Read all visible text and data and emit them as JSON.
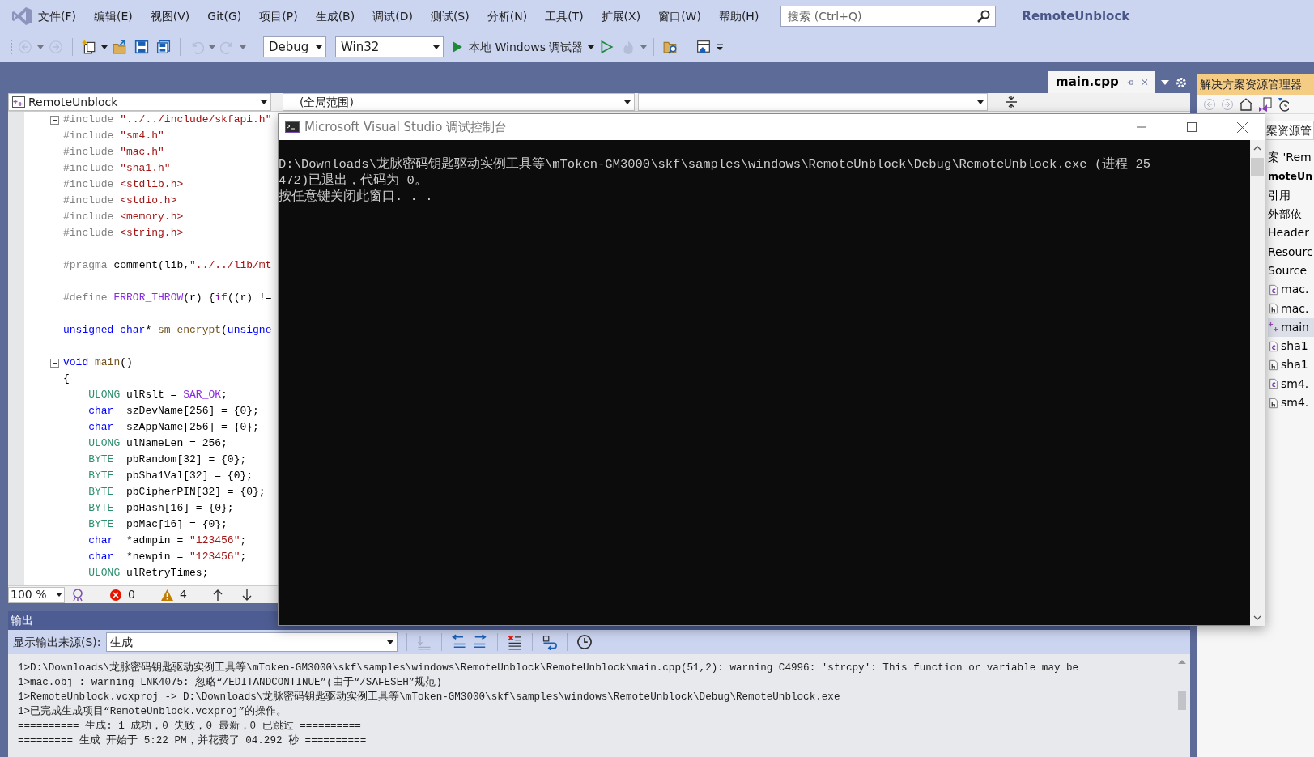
{
  "menu": [
    "文件(F)",
    "编辑(E)",
    "视图(V)",
    "Git(G)",
    "项目(P)",
    "生成(B)",
    "调试(D)",
    "测试(S)",
    "分析(N)",
    "工具(T)",
    "扩展(X)",
    "窗口(W)",
    "帮助(H)"
  ],
  "search": {
    "placeholder": "搜索 (Ctrl+Q)"
  },
  "solution_title": "RemoteUnblock",
  "toolbar": [
    {
      "kind": "back",
      "disabled": true
    },
    {
      "kind": "forward",
      "disabled": true
    },
    {
      "kind": "new",
      "disabled": false
    },
    {
      "kind": "open",
      "disabled": false
    },
    {
      "kind": "save",
      "disabled": false
    },
    {
      "kind": "save_all",
      "disabled": false
    },
    {
      "kind": "undo",
      "disabled": true
    },
    {
      "kind": "redo",
      "disabled": true
    },
    {
      "kind": "select",
      "text": "Debug"
    },
    {
      "kind": "select",
      "text": "Win32"
    },
    {
      "kind": "start",
      "text": "本地 Windows 调试器"
    },
    {
      "kind": "start_nodebug",
      "disabled": false
    },
    {
      "kind": "hot_reload",
      "disabled": true
    },
    {
      "kind": "find_files",
      "disabled": false
    },
    {
      "kind": "window",
      "disabled": false
    }
  ],
  "editor_tab": {
    "label": "main.cpp",
    "selected": true
  },
  "nav_bar": {
    "project": "RemoteUnblock",
    "scope": "(全局范围)"
  },
  "code_lines": [
    {
      "kind": "region",
      "segs": [
        {
          "t": "#include ",
          "kind": "pp"
        },
        {
          "t": "\"../../include/skfapi.h\"",
          "kind": "str"
        }
      ]
    },
    {
      "kind": "line",
      "segs": [
        {
          "t": "#include ",
          "kind": "pp"
        },
        {
          "t": "\"sm4.h\"",
          "kind": "str"
        }
      ]
    },
    {
      "kind": "line",
      "segs": [
        {
          "t": "#include ",
          "kind": "pp"
        },
        {
          "t": "\"mac.h\"",
          "kind": "str"
        }
      ]
    },
    {
      "kind": "line",
      "segs": [
        {
          "t": "#include ",
          "kind": "pp"
        },
        {
          "t": "\"sha1.h\"",
          "kind": "str"
        }
      ]
    },
    {
      "kind": "line",
      "segs": [
        {
          "t": "#include ",
          "kind": "pp"
        },
        {
          "t": "<stdlib.h>",
          "kind": "str"
        }
      ]
    },
    {
      "kind": "line",
      "segs": [
        {
          "t": "#include ",
          "kind": "pp"
        },
        {
          "t": "<stdio.h>",
          "kind": "str"
        }
      ]
    },
    {
      "kind": "line",
      "segs": [
        {
          "t": "#include ",
          "kind": "pp"
        },
        {
          "t": "<memory.h>",
          "kind": "str"
        }
      ]
    },
    {
      "kind": "line",
      "segs": [
        {
          "t": "#include ",
          "kind": "pp"
        },
        {
          "t": "<string.h>",
          "kind": "str"
        }
      ]
    },
    {
      "kind": "blank"
    },
    {
      "kind": "line",
      "segs": [
        {
          "t": "#pragma ",
          "kind": "pp"
        },
        {
          "t": "comment(lib,",
          "kind": "plain"
        },
        {
          "t": "\"../../lib/mt",
          "kind": "str"
        }
      ]
    },
    {
      "kind": "blank"
    },
    {
      "kind": "line",
      "segs": [
        {
          "t": "#define ",
          "kind": "pp"
        },
        {
          "t": "ERROR_THROW",
          "kind": "macro"
        },
        {
          "t": "(r) {",
          "kind": "plain"
        },
        {
          "t": "if",
          "kind": "ctrl"
        },
        {
          "t": "((r) !=",
          "kind": "plain"
        }
      ]
    },
    {
      "kind": "blank"
    },
    {
      "kind": "line",
      "segs": [
        {
          "t": "unsigned char",
          "kind": "kw"
        },
        {
          "t": "* ",
          "kind": "plain"
        },
        {
          "t": "sm_encrypt",
          "kind": "func"
        },
        {
          "t": "(",
          "kind": "plain"
        },
        {
          "t": "unsigne",
          "kind": "kw"
        }
      ]
    },
    {
      "kind": "blank"
    },
    {
      "kind": "region",
      "segs": [
        {
          "t": "void ",
          "kind": "kw"
        },
        {
          "t": "main",
          "kind": "func"
        },
        {
          "t": "()",
          "kind": "plain"
        }
      ]
    },
    {
      "kind": "line",
      "segs": [
        {
          "t": "{",
          "kind": "plain"
        }
      ]
    },
    {
      "kind": "line",
      "segs": [
        {
          "t": "    ULONG ",
          "kind": "type"
        },
        {
          "t": "ulRslt = ",
          "kind": "plain"
        },
        {
          "t": "SAR_OK",
          "kind": "macro"
        },
        {
          "t": ";",
          "kind": "plain"
        }
      ]
    },
    {
      "kind": "line",
      "segs": [
        {
          "t": "    char  ",
          "kind": "kw"
        },
        {
          "t": "szDevName[256] = {0};",
          "kind": "plain"
        }
      ]
    },
    {
      "kind": "line",
      "segs": [
        {
          "t": "    char  ",
          "kind": "kw"
        },
        {
          "t": "szAppName[256] = {0};",
          "kind": "plain"
        }
      ]
    },
    {
      "kind": "line",
      "segs": [
        {
          "t": "    ULONG ",
          "kind": "type"
        },
        {
          "t": "ulNameLen = 256;",
          "kind": "plain"
        }
      ]
    },
    {
      "kind": "line",
      "segs": [
        {
          "t": "    BYTE  ",
          "kind": "type"
        },
        {
          "t": "pbRandom[32] = {0};",
          "kind": "plain"
        }
      ]
    },
    {
      "kind": "line",
      "segs": [
        {
          "t": "    BYTE  ",
          "kind": "type"
        },
        {
          "t": "pbSha1Val[32] = {0};",
          "kind": "plain"
        }
      ]
    },
    {
      "kind": "line",
      "segs": [
        {
          "t": "    BYTE  ",
          "kind": "type"
        },
        {
          "t": "pbCipherPIN[32] = {0};",
          "kind": "plain"
        }
      ]
    },
    {
      "kind": "line",
      "segs": [
        {
          "t": "    BYTE  ",
          "kind": "type"
        },
        {
          "t": "pbHash[16] = {0};",
          "kind": "plain"
        }
      ]
    },
    {
      "kind": "line",
      "segs": [
        {
          "t": "    BYTE  ",
          "kind": "type"
        },
        {
          "t": "pbMac[16] = {0};",
          "kind": "plain"
        }
      ]
    },
    {
      "kind": "line",
      "segs": [
        {
          "t": "    char  ",
          "kind": "kw"
        },
        {
          "t": "*admpin = ",
          "kind": "plain"
        },
        {
          "t": "\"123456\"",
          "kind": "str"
        },
        {
          "t": ";",
          "kind": "plain"
        }
      ]
    },
    {
      "kind": "line",
      "segs": [
        {
          "t": "    char  ",
          "kind": "kw"
        },
        {
          "t": "*newpin = ",
          "kind": "plain"
        },
        {
          "t": "\"123456\"",
          "kind": "str"
        },
        {
          "t": ";",
          "kind": "plain"
        }
      ]
    },
    {
      "kind": "line",
      "segs": [
        {
          "t": "    ULONG ",
          "kind": "type"
        },
        {
          "t": "ulRetryTimes;",
          "kind": "plain"
        }
      ]
    }
  ],
  "editor_status": {
    "zoom": "100 %",
    "errors": "0",
    "warnings": "4"
  },
  "solution_explorer": {
    "title": "解决方案资源管理器",
    "search_text": "案资源管",
    "items": [
      {
        "label": "案 'Rem",
        "kind": "solution",
        "selected": false
      },
      {
        "label": "moteUn",
        "kind": "project",
        "selected": false
      },
      {
        "label": "引用",
        "kind": "folder",
        "selected": false
      },
      {
        "label": "外部依",
        "kind": "folder",
        "selected": false
      },
      {
        "label": "Header",
        "kind": "folder",
        "selected": false
      },
      {
        "label": "Resourc",
        "kind": "folder",
        "selected": false
      },
      {
        "label": "Source",
        "kind": "folder",
        "selected": false
      },
      {
        "label": "mac.",
        "kind": "c",
        "selected": false
      },
      {
        "label": "mac.",
        "kind": "h",
        "selected": false
      },
      {
        "label": "main",
        "kind": "cpp",
        "selected": true
      },
      {
        "label": "sha1",
        "kind": "c",
        "selected": false
      },
      {
        "label": "sha1",
        "kind": "h",
        "selected": false
      },
      {
        "label": "sm4.",
        "kind": "c",
        "selected": false
      },
      {
        "label": "sm4.",
        "kind": "h",
        "selected": false
      }
    ]
  },
  "console": {
    "title": "Microsoft Visual Studio 调试控制台",
    "lines": [
      "D:\\Downloads\\龙脉密码钥匙驱动实例工具等\\mToken-GM3000\\skf\\samples\\windows\\RemoteUnblock\\Debug\\RemoteUnblock.exe (进程 25",
      "472)已退出，代码为 0。",
      "按任意键关闭此窗口. . ."
    ]
  },
  "output": {
    "title": "输出",
    "source_label": "显示输出来源(S):",
    "source": "生成",
    "lines": [
      "1>D:\\Downloads\\龙脉密码钥匙驱动实例工具等\\mToken-GM3000\\skf\\samples\\windows\\RemoteUnblock\\RemoteUnblock\\main.cpp(51,2): warning C4996: 'strcpy': This function or variable may be",
      "1>mac.obj : warning LNK4075: 忽略“/EDITANDCONTINUE”(由于“/SAFESEH”规范)",
      "1>RemoteUnblock.vcxproj -> D:\\Downloads\\龙脉密码钥匙驱动实例工具等\\mToken-GM3000\\skf\\samples\\windows\\RemoteUnblock\\Debug\\RemoteUnblock.exe",
      "1>已完成生成项目“RemoteUnblock.vcxproj”的操作。",
      "========== 生成: 1 成功，0 失败，0 最新，0 已跳过 ==========",
      "========= 生成 开始于 5:22 PM，并花费了 04.292 秒 =========="
    ]
  }
}
